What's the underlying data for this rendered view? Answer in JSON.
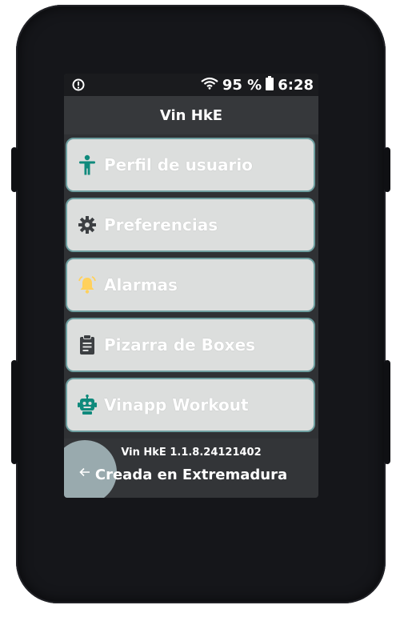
{
  "statusbar": {
    "alert_icon": "alert-circle-icon",
    "wifi_icon": "wifi-icon",
    "battery_percent": "95 %",
    "battery_icon": "battery-icon",
    "time": "6:28"
  },
  "header": {
    "title": "Vin HkE"
  },
  "menu": {
    "items": [
      {
        "label": "Perfil de usuario",
        "icon": "person-icon"
      },
      {
        "label": "Preferencias",
        "icon": "gear-icon"
      },
      {
        "label": "Alarmas",
        "icon": "bell-icon"
      },
      {
        "label": "Pizarra de Boxes",
        "icon": "clipboard-icon"
      },
      {
        "label": "Vinapp Workout",
        "icon": "robot-icon"
      }
    ]
  },
  "footer": {
    "version": "Vin HkE 1.1.8.24121402",
    "made_in": "Creada en Extremadura",
    "back_icon": "arrow-left-icon"
  },
  "colors": {
    "accent_teal": "#0f8a7c",
    "bell_yellow": "#ffd15c",
    "item_bg": "#dcdedd",
    "item_border": "#6e9fa0"
  }
}
